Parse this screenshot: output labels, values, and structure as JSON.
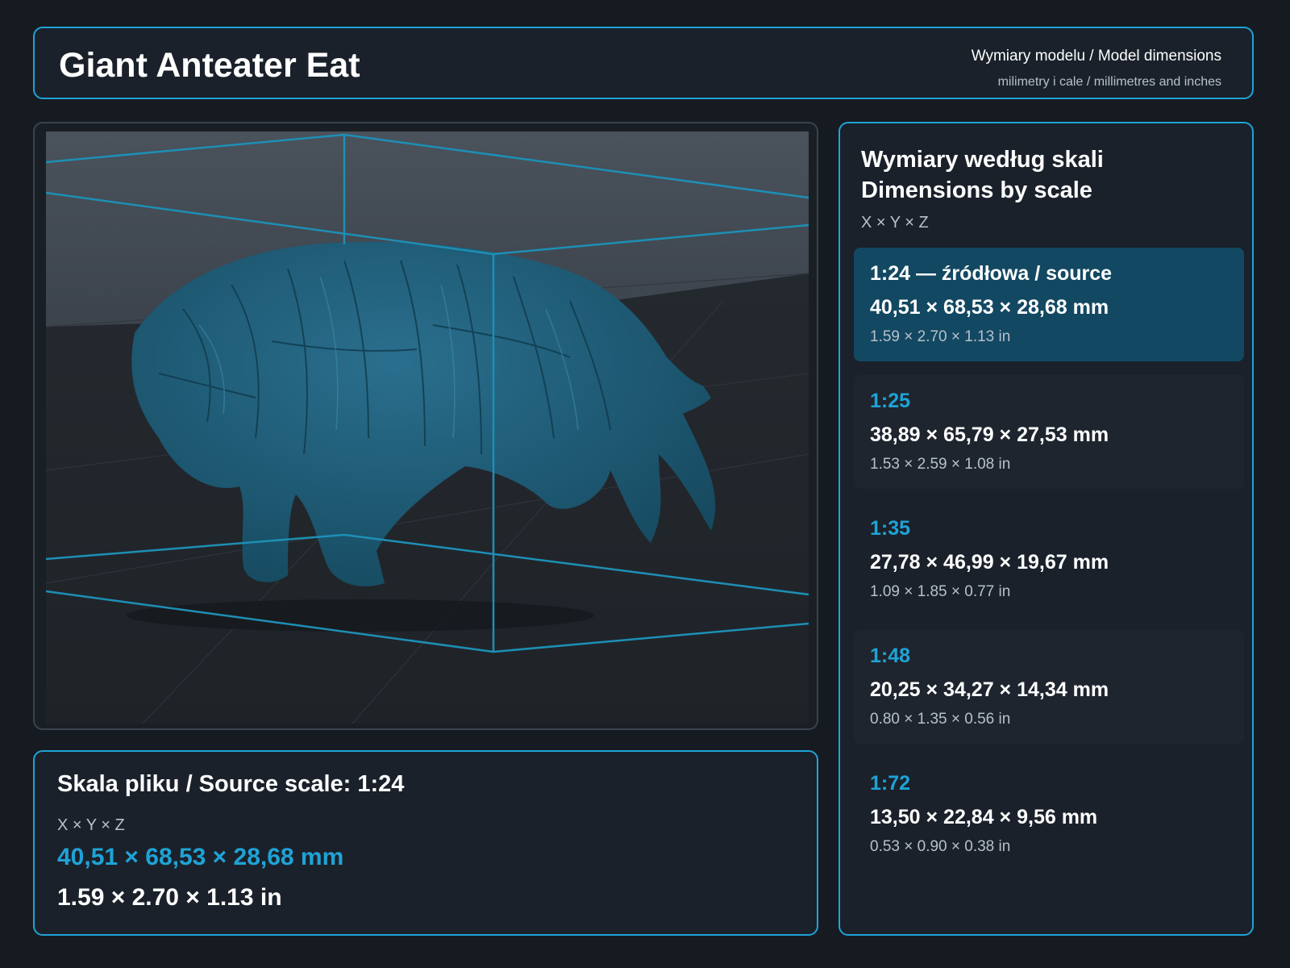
{
  "header": {
    "title": "Giant Anteater Eat",
    "subtitle": "Wymiary modelu / Model dimensions",
    "units_note": "milimetry i cale / millimetres and inches"
  },
  "colors": {
    "accent": "#1fa3d6",
    "background": "#161b22",
    "panel": "#1a212a",
    "active_card": "#134862",
    "model": "#1d5c78"
  },
  "viewer": {
    "model_icon": "anteater-3d-model"
  },
  "source_info": {
    "heading": "Skala pliku / Source scale: 1:24",
    "axes_label": "X × Y × Z",
    "mm": "40,51 × 68,53 × 28,68 mm",
    "inches": "1.59 × 2.70 × 1.13 in"
  },
  "scales": {
    "heading_line1": "Wymiary według skali",
    "heading_line2": "Dimensions by scale",
    "axes_label": "X × Y × Z",
    "items": [
      {
        "scale": "1:24  —  źródłowa / source",
        "mm": "40,51 × 68,53 × 28,68 mm",
        "inches": "1.59 × 2.70 × 1.13 in"
      },
      {
        "scale": "1:25",
        "mm": "38,89 × 65,79 × 27,53 mm",
        "inches": "1.53 × 2.59 × 1.08 in"
      },
      {
        "scale": "1:35",
        "mm": "27,78 × 46,99 × 19,67 mm",
        "inches": "1.09 × 1.85 × 0.77 in"
      },
      {
        "scale": "1:48",
        "mm": "20,25 × 34,27 × 14,34 mm",
        "inches": "0.80 × 1.35 × 0.56 in"
      },
      {
        "scale": "1:72",
        "mm": "13,50 × 22,84 × 9,56 mm",
        "inches": "0.53 × 0.90 × 0.38 in"
      }
    ]
  }
}
